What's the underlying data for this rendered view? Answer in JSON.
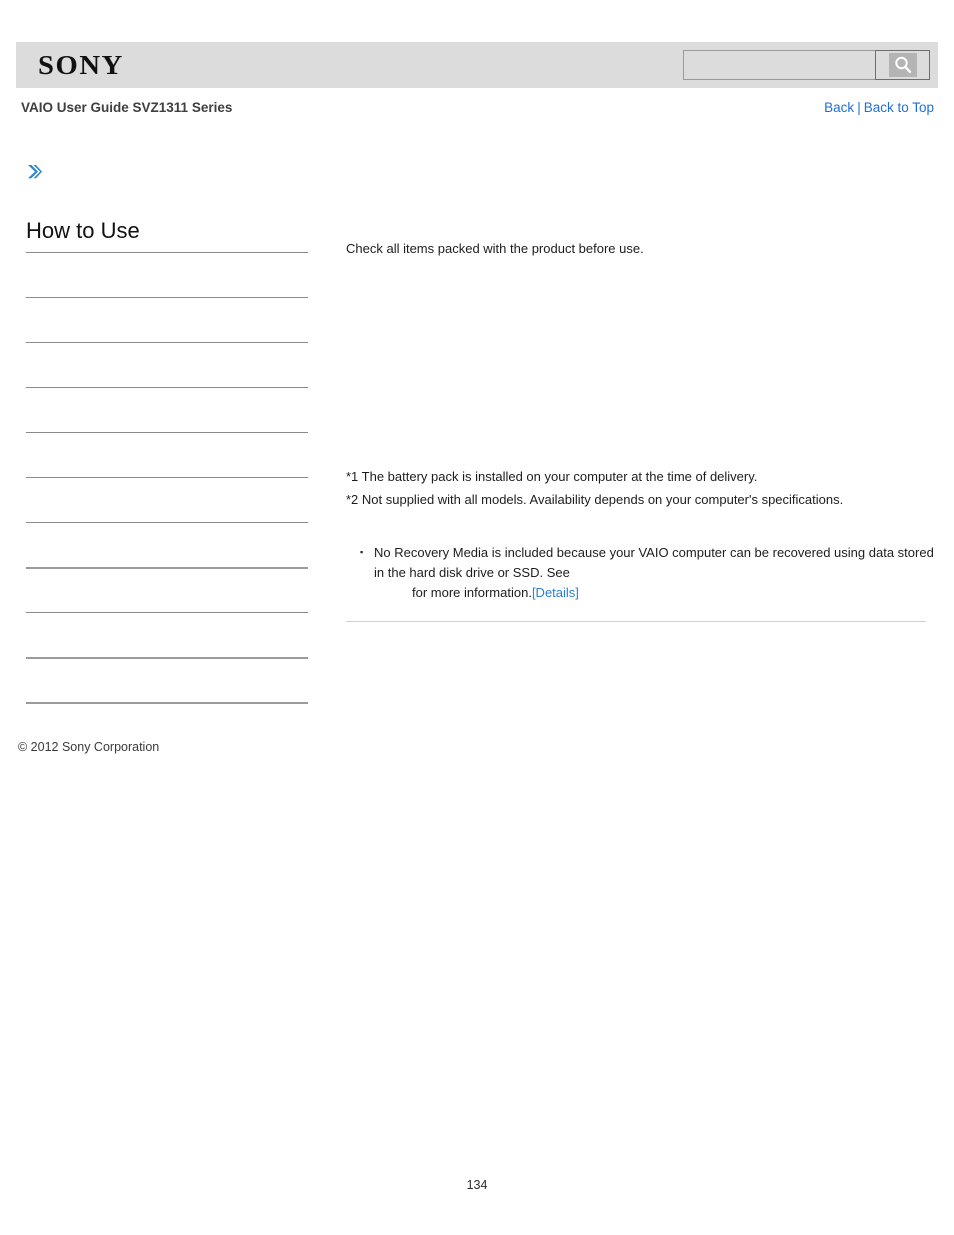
{
  "header": {
    "logo_text": "SONY",
    "search": {
      "value": "",
      "placeholder": "",
      "icon": "search-icon",
      "button_label": ""
    }
  },
  "title_bar": {
    "guide_title": "VAIO User Guide SVZ1311 Series",
    "back_label": "Back",
    "separator": "|",
    "back_to_top_label": "Back to Top"
  },
  "breadcrumb": {
    "icon": "chevron-right-icon",
    "text": ""
  },
  "sidebar": {
    "heading": "How to Use",
    "items": [
      {
        "label": ""
      },
      {
        "label": ""
      },
      {
        "label": ""
      },
      {
        "label": ""
      },
      {
        "label": ""
      },
      {
        "label": ""
      },
      {
        "label": ""
      },
      {
        "label": ""
      },
      {
        "label": ""
      },
      {
        "label": ""
      }
    ]
  },
  "main": {
    "intro": "Check all items packed with the product before use.",
    "footnotes": [
      "*1 The battery pack is installed on your computer at the time of delivery.",
      "*2 Not supplied with all models. Availability depends on your computer's specifications."
    ],
    "bullets": [
      {
        "line1": "No Recovery Media is included because your VAIO computer can be recovered using",
        "line2": "data stored in the hard disk drive or SSD. See",
        "line3": "for more information.",
        "link_label": "[Details]"
      }
    ]
  },
  "footer": {
    "copyright": "© 2012 Sony Corporation",
    "page_number": "134"
  },
  "colors": {
    "header_band": "#dcdcdc",
    "link_blue": "#1e6fd9",
    "details_blue": "#2a7fd4",
    "rule_gray": "#8a8a8a"
  }
}
